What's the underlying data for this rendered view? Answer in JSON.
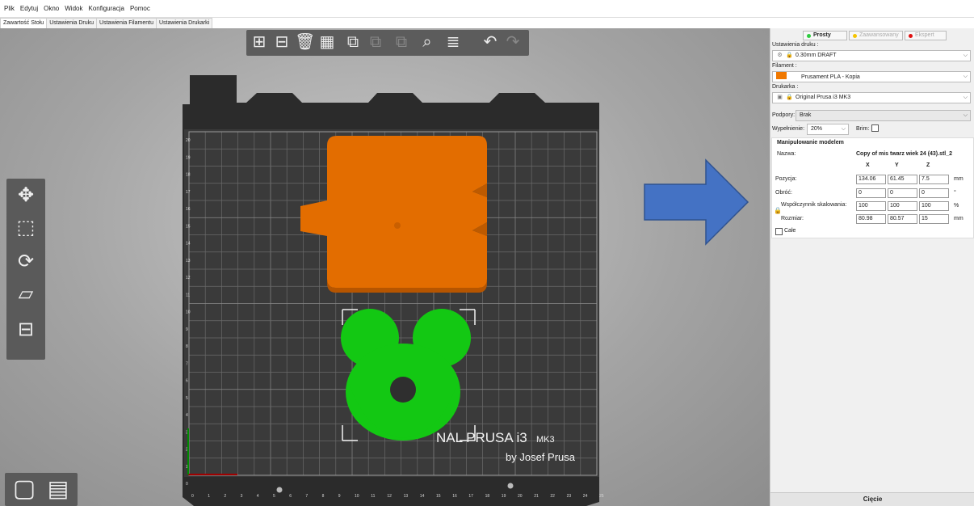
{
  "menu": [
    "Plik",
    "Edytuj",
    "Okno",
    "Widok",
    "Konfiguracja",
    "Pomoc"
  ],
  "tabs": [
    "Zawartość Stołu",
    "Ustawienia Druku",
    "Ustawienia Filamentu",
    "Ustawienia Drukarki"
  ],
  "bed": {
    "x_ticks": [
      "0",
      "1",
      "2",
      "3",
      "4",
      "5",
      "6",
      "7",
      "8",
      "9",
      "10",
      "11",
      "12",
      "13",
      "14",
      "15",
      "16",
      "17",
      "18",
      "19",
      "20",
      "21",
      "22",
      "23",
      "24",
      "25"
    ],
    "y_ticks": [
      "20",
      "19",
      "18",
      "17",
      "16",
      "15",
      "14",
      "13",
      "12",
      "11",
      "10",
      "9",
      "8",
      "7",
      "6",
      "5",
      "4",
      "3",
      "2",
      "1",
      "0"
    ],
    "logo_main": "NAL PRUSA i3",
    "logo_model": "MK3",
    "logo_by": "by Josef Prusa"
  },
  "sidebar": {
    "modes": [
      {
        "label": "Prosty",
        "color": "#2ecc40"
      },
      {
        "label": "Zaawansowany",
        "color": "#f5c400"
      },
      {
        "label": "Ekspert",
        "color": "#e01010"
      }
    ],
    "print_settings_label": "Ustawienia druku :",
    "print_settings_value": "0.30mm DRAFT",
    "filament_label": "Filament :",
    "filament_value": "Prusament PLA - Kopia",
    "filament_color": "#f07800",
    "printer_label": "Drukarka :",
    "printer_value": "Original Prusa i3 MK3",
    "supports_label": "Podpory:",
    "supports_value": "Brak",
    "infill_label": "Wypełnienie:",
    "infill_value": "20%",
    "brim_label": "Brim:",
    "manip": {
      "title": "Manipulowanie modelem",
      "name_label": "Nazwa:",
      "name_value": "Copy of mis twarz wiek 24 (43).stl_2",
      "col_x": "X",
      "col_y": "Y",
      "col_z": "Z",
      "position_label": "Pozycja:",
      "position": [
        "134.06",
        "61.45",
        "7.5"
      ],
      "position_unit": "mm",
      "rotate_label": "Obróć:",
      "rotate": [
        "0",
        "0",
        "0"
      ],
      "rotate_unit": "°",
      "scale_label": "Współczynnik skalowania:",
      "scale": [
        "100",
        "100",
        "100"
      ],
      "scale_unit": "%",
      "size_label": "Rozmiar:",
      "size": [
        "80.98",
        "80.57",
        "15"
      ],
      "size_unit": "mm",
      "whole_label": "Całe"
    },
    "slice_label": "Cięcie"
  }
}
